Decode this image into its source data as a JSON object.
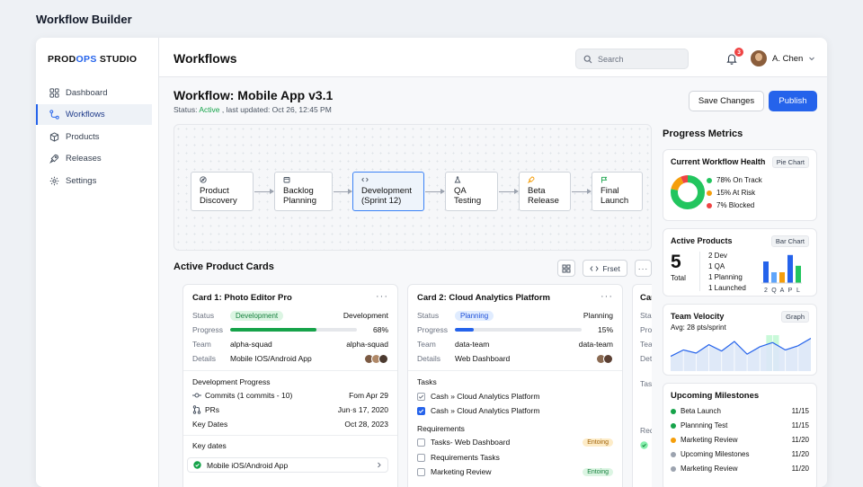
{
  "window_title": "Workflow Builder",
  "brand": {
    "pre": "PROD",
    "accent": "OPS",
    "post": " STUDIO"
  },
  "sidebar": {
    "items": [
      {
        "label": "Dashboard",
        "icon": "dashboard-icon"
      },
      {
        "label": "Workflows",
        "icon": "workflow-icon",
        "active": true
      },
      {
        "label": "Products",
        "icon": "box-icon"
      },
      {
        "label": "Releases",
        "icon": "rocket-icon"
      },
      {
        "label": "Settings",
        "icon": "gear-icon"
      }
    ]
  },
  "header": {
    "title": "Workflows",
    "search_placeholder": "Search",
    "notifications": "3",
    "user": "A. Chen"
  },
  "workflow": {
    "title": "Workflow: Mobile App v3.1",
    "status_prefix": "Status:",
    "status": "Active",
    "updated": ", last updated: Oct 26, 12:45 PM",
    "save_label": "Save Changes",
    "publish_label": "Publish",
    "nodes": [
      {
        "l1": "Product",
        "l2": "Discovery",
        "icon": "compass-icon"
      },
      {
        "l1": "Backlog",
        "l2": "Planning",
        "icon": "calendar-icon"
      },
      {
        "l1": "Development",
        "l2": "(Sprint 12)",
        "icon": "code-icon",
        "selected": true
      },
      {
        "l1": "QA",
        "l2": "Testing",
        "icon": "flask-icon"
      },
      {
        "l1": "Beta",
        "l2": "Release",
        "icon": "rocket-icon"
      },
      {
        "l1": "Final",
        "l2": "Launch",
        "icon": "flag-icon"
      }
    ]
  },
  "cards_section": {
    "title": "Active Product Cards",
    "reset_label": "Frset"
  },
  "card1": {
    "title": "Card 1: Photo Editor Pro",
    "status_label": "Status",
    "status": "Development",
    "status_right": "Development",
    "progress_label": "Progress",
    "progress": 68,
    "progress_text": "68%",
    "team_label": "Team",
    "team": "alpha-squad",
    "team_right": "alpha-squad",
    "details_label": "Details",
    "details": "Mobile IOS/Android App",
    "dev_h": "Development Progress",
    "commits": "Commits (1 commits - 10)",
    "commits_right": "Fom Apr 29",
    "prs": "PRs",
    "prs_right": "Jun·s 17, 2020",
    "keydates_row": "Key Dates",
    "keydates_right": "Oct 28, 2023",
    "keydates_h": "Key dates",
    "keydate_item": "Mobile iOS/Android App"
  },
  "card2": {
    "title": "Card 2: Cloud Analytics Platform",
    "status_label": "Status",
    "status": "Planning",
    "status_right": "Planning",
    "progress_label": "Progress",
    "progress": 15,
    "progress_text": "15%",
    "team_label": "Team",
    "team": "data-team",
    "team_right": "data-team",
    "details_label": "Details",
    "details": "Web Dashboard",
    "tasks_h": "Tasks",
    "tasks": [
      "Cash » Cloud Analytics Platform",
      "Cash » Cloud Analytics Platform"
    ],
    "req_h": "Requirements",
    "reqs": [
      {
        "label": "Tasks- Web Dashboard",
        "tag": "Entoing",
        "tag_color": "amber"
      },
      {
        "label": "Requirements Tasks",
        "tag": "",
        "tag_color": ""
      },
      {
        "label": "Marketing Review",
        "tag": "Entoing",
        "tag_color": "green"
      }
    ]
  },
  "card3": {
    "title": "Car",
    "labels": [
      "Status",
      "Progress",
      "Team",
      "Details",
      "Tas",
      "Req"
    ]
  },
  "metrics": {
    "title": "Progress Metrics",
    "health": {
      "title": "Current Workflow Health",
      "tag": "Pie Chart",
      "items": [
        {
          "label": "78% On Track",
          "value": 78,
          "color": "#22c55e"
        },
        {
          "label": "15% At Risk",
          "value": 15,
          "color": "#f59e0b"
        },
        {
          "label": "7% Blocked",
          "value": 7,
          "color": "#ef4444"
        }
      ]
    },
    "products": {
      "title": "Active Products",
      "tag": "Bar Chart",
      "total": "5",
      "total_label": "Total",
      "breakdown": [
        "2 Dev",
        "1 QA",
        "1 Planning",
        "1 Launched"
      ],
      "bar_labels": [
        "2",
        "Q",
        "A",
        "P",
        "L"
      ],
      "bar_values": [
        2,
        1,
        1,
        2.6,
        1.6
      ],
      "bar_colors": [
        "#2563eb",
        "#60a5fa",
        "#f59e0b",
        "#2563eb",
        "#22c55e"
      ]
    },
    "velocity": {
      "title": "Team Velocity",
      "tag": "Graph",
      "avg": "Avg: 28 pts/sprint",
      "points": [
        14,
        20,
        17,
        25,
        19,
        28,
        16,
        23,
        27,
        20,
        24,
        31
      ]
    },
    "milestones": {
      "title": "Upcoming Milestones",
      "items": [
        {
          "label": "Beta Launch",
          "date": "11/15",
          "color": "#16a34a"
        },
        {
          "label": "Plannning Test",
          "date": "11/15",
          "color": "#16a34a"
        },
        {
          "label": "Marketing Review",
          "date": "11/20",
          "color": "#f59e0b"
        },
        {
          "label": "Upcoming Milestones",
          "date": "11/20",
          "color": "#9ca3af"
        },
        {
          "label": "Marketing Review",
          "date": "11/20",
          "color": "#9ca3af"
        }
      ]
    }
  }
}
